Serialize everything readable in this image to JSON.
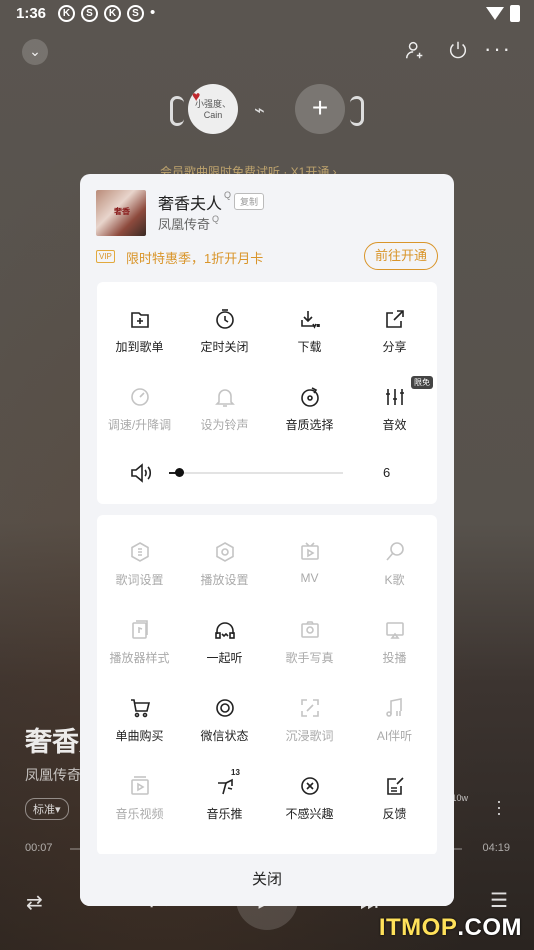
{
  "status_bar": {
    "time": "1:36",
    "icons": [
      "K",
      "S",
      "K",
      "S"
    ],
    "dot": "•"
  },
  "top_bar": {
    "more": "···"
  },
  "avatar": {
    "label": "小强度、Cain"
  },
  "vip_strip": "会员歌曲限时免费试听 · X1开通 ›",
  "player": {
    "title": "奢香夫人",
    "artist": "凤凰传奇",
    "quality": "标准▾",
    "current_time": "00:07",
    "total_time": "04:19",
    "count": "10w"
  },
  "sheet": {
    "song": {
      "name": "奢香夫人",
      "artist": "凤凰传奇",
      "copy_label": "复制",
      "cover_text": "奢香"
    },
    "vip": {
      "badge": "VIP",
      "text": "限时特惠季，1折开月卡",
      "button": "前往开通"
    },
    "actions_top": [
      {
        "label": "加到歌单",
        "icon": "add-to-playlist-icon",
        "enabled": true
      },
      {
        "label": "定时关闭",
        "icon": "timer-icon",
        "enabled": true
      },
      {
        "label": "下载",
        "icon": "download-vip-icon",
        "enabled": true
      },
      {
        "label": "分享",
        "icon": "share-icon",
        "enabled": true
      },
      {
        "label": "调速/升降调",
        "icon": "speed-icon",
        "enabled": false
      },
      {
        "label": "设为铃声",
        "icon": "bell-icon",
        "enabled": false
      },
      {
        "label": "音质选择",
        "icon": "quality-disc-icon",
        "enabled": true
      },
      {
        "label": "音效",
        "icon": "equalizer-icon",
        "enabled": true,
        "badge": "限免"
      }
    ],
    "volume": {
      "value": "6",
      "level_fraction": 0.06
    },
    "actions_more": [
      {
        "label": "歌词设置",
        "icon": "lyrics-icon",
        "enabled": false
      },
      {
        "label": "播放设置",
        "icon": "play-settings-icon",
        "enabled": false
      },
      {
        "label": "MV",
        "icon": "mv-icon",
        "enabled": false
      },
      {
        "label": "K歌",
        "icon": "karaoke-mic-icon",
        "enabled": false
      },
      {
        "label": "播放器样式",
        "icon": "player-style-icon",
        "enabled": false
      },
      {
        "label": "一起听",
        "icon": "listen-together-icon",
        "enabled": true
      },
      {
        "label": "歌手写真",
        "icon": "artist-photo-icon",
        "enabled": false
      },
      {
        "label": "投播",
        "icon": "cast-icon",
        "enabled": false
      },
      {
        "label": "单曲购买",
        "icon": "cart-icon",
        "enabled": true
      },
      {
        "label": "微信状态",
        "icon": "wechat-status-icon",
        "enabled": true
      },
      {
        "label": "沉浸歌词",
        "icon": "immersive-lyrics-icon",
        "enabled": false
      },
      {
        "label": "AI伴听",
        "icon": "ai-dj-icon",
        "enabled": false
      },
      {
        "label": "音乐视频",
        "icon": "music-video-icon",
        "enabled": false
      },
      {
        "label": "音乐推",
        "icon": "music-push-icon",
        "enabled": true,
        "superscript": "13"
      },
      {
        "label": "不感兴趣",
        "icon": "not-interested-icon",
        "enabled": true
      },
      {
        "label": "反馈",
        "icon": "feedback-icon",
        "enabled": true
      }
    ],
    "close_label": "关闭"
  },
  "watermark": {
    "brand": "ITMOP",
    "suffix": ".COM"
  }
}
